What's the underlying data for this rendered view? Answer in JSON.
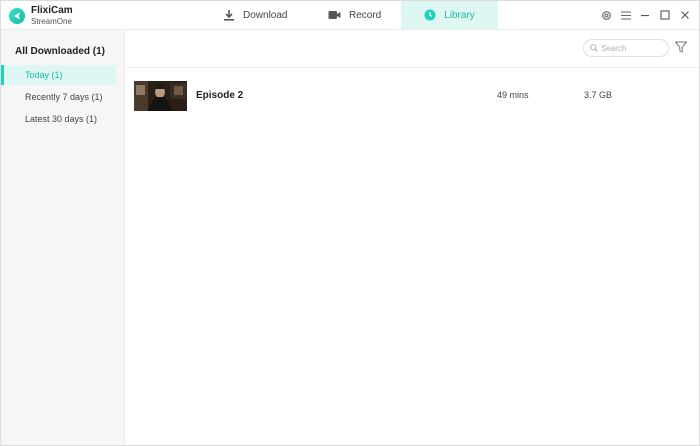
{
  "app": {
    "name": "FlixiCam",
    "subtitle": "StreamOne"
  },
  "nav": {
    "download": "Download",
    "record": "Record",
    "library": "Library",
    "active": "library"
  },
  "window_controls": [
    "settings-icon",
    "menu-icon",
    "minimize-icon",
    "maximize-icon",
    "close-icon"
  ],
  "sidebar": {
    "header": "All Downloaded (1)",
    "items": [
      {
        "label": "Today (1)",
        "active": true
      },
      {
        "label": "Recently 7 days (1)",
        "active": false
      },
      {
        "label": "Latest 30 days (1)",
        "active": false
      }
    ]
  },
  "toolbar": {
    "search_placeholder": "Search",
    "filter_icon": "filter-icon"
  },
  "library": {
    "items": [
      {
        "title": "Episode 2",
        "duration": "49 mins",
        "size": "3.7 GB"
      }
    ]
  },
  "colors": {
    "accent": "#1ed1b8",
    "accent_text": "#1cb9a5",
    "active_bg": "#dff7f3",
    "sidebar_bg": "#f6f6f6"
  }
}
